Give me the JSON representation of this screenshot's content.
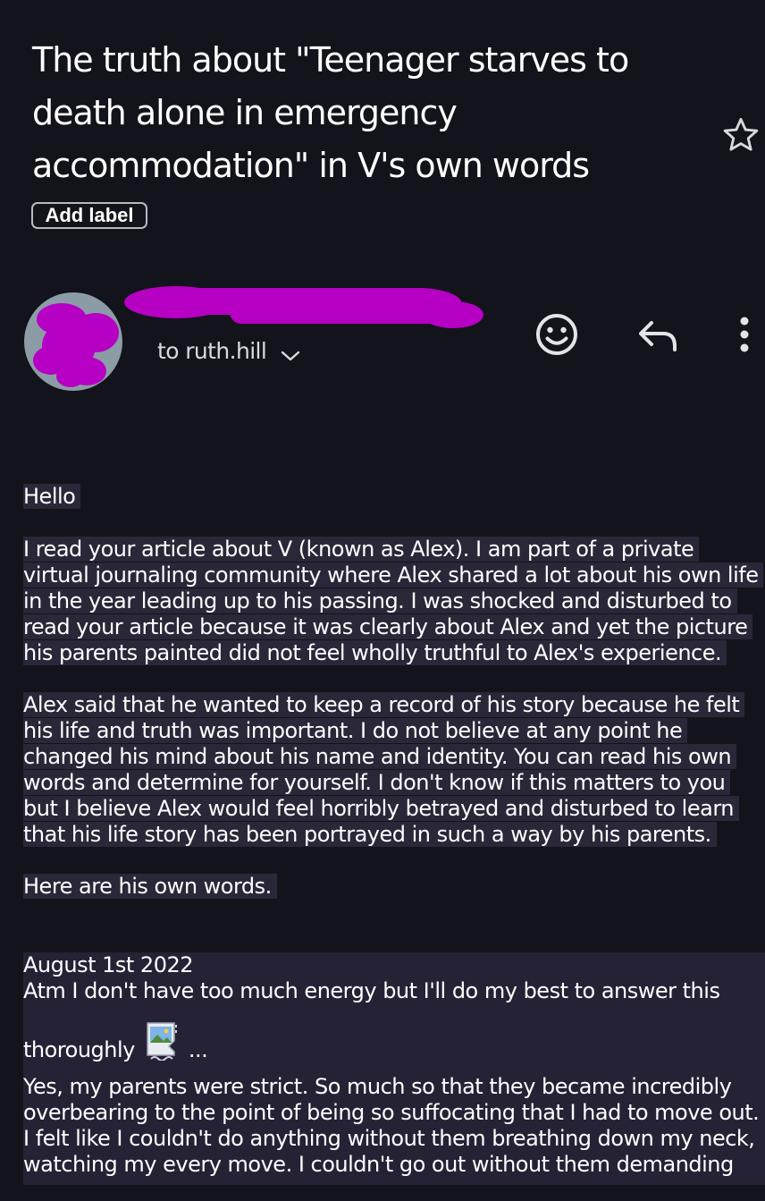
{
  "email": {
    "subject": "The truth about \"Teenager starves to death alone in emergency accommodation\" in V's own words",
    "add_label": "Add label",
    "recipient": "to ruth.hill",
    "icons": {
      "star": "star-outline-icon",
      "react": "emoji-icon",
      "reply": "reply-icon",
      "more": "more-vert-icon",
      "recipient_details": "chevron-down-icon"
    },
    "colors": {
      "background": "#13131c",
      "highlight": "#2a2739",
      "redaction": "#b600c4"
    }
  },
  "body": {
    "greeting": "Hello",
    "intro": "I read your article about V (known as Alex). I am part of a private virtual journaling community where Alex shared a lot about his own life in the year leading up to his passing. I was shocked and disturbed to read your article because it was clearly about Alex and yet the picture his parents painted did not feel wholly truthful to Alex's experience.",
    "record": "Alex said that he wanted to keep a record of his story because he felt his life and truth was important. I do not believe at any point he changed his mind about his name and identity. You can read his own words and determine for yourself. I don't know if this matters to you but I believe Alex would feel horribly betrayed and disturbed to learn that his life story has been portrayed in such a way by his parents.",
    "here": "Here are his own words."
  },
  "quote": {
    "date": "August 1st 2022",
    "line1": "Atm I don't have too much energy but I'll do my best to answer this",
    "line2_start": "thoroughly",
    "line2_end": "...",
    "paragraph": "Yes, my parents were strict. So much so that they became incredibly overbearing to the point of being so suffocating that I had to move out. I felt like I couldn't do anything without them breathing down my neck, watching my every move. I couldn't go out without them demanding"
  }
}
